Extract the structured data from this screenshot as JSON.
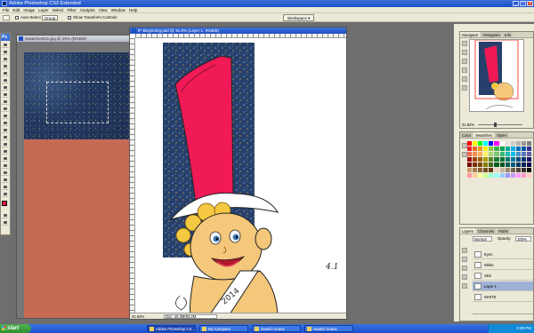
{
  "window": {
    "title": "Adobe Photoshop CS3 Extended",
    "min": "_",
    "max": "□",
    "close": "×"
  },
  "menu": [
    "File",
    "Edit",
    "Image",
    "Layer",
    "Select",
    "Filter",
    "Analysis",
    "View",
    "Window",
    "Help"
  ],
  "options": {
    "auto_select": "Auto-Select",
    "auto_select_value": "Group",
    "show_transform": "Show Transform Controls",
    "workspace": "Workspace ▾"
  },
  "toolbox": {
    "header": "Ps"
  },
  "doc1": {
    "title": "Swatches011.jpg @ 25% (RGB/8)"
  },
  "doc2": {
    "title": "IF-Beginning.psd @ 31.8% (Layer 1, RGB/8)",
    "zoom": "31.82%",
    "doc_size": "Doc: 40.2M/94.2M",
    "signature": "4.1"
  },
  "navigator": {
    "tabs": [
      "Navigator",
      "Histogram",
      "Info"
    ],
    "zoom": "31.82%"
  },
  "swatches": {
    "tabs": [
      "Color",
      "Swatches",
      "Styles"
    ],
    "colors": [
      "#ff0000",
      "#ffff00",
      "#00ff00",
      "#00ffff",
      "#0000ff",
      "#ff00ff",
      "#ffffff",
      "#e6e6e6",
      "#cccccc",
      "#b3b3b3",
      "#999999",
      "#808080",
      "#ed1c24",
      "#f26522",
      "#f7941d",
      "#fff200",
      "#8dc63f",
      "#39b54a",
      "#00a651",
      "#00a99d",
      "#00aeef",
      "#0072bc",
      "#0054a6",
      "#2e3192",
      "#f26c4f",
      "#f68e56",
      "#fbaf5d",
      "#fff568",
      "#acd373",
      "#7cc576",
      "#3cb878",
      "#1cbbb4",
      "#00bff3",
      "#448ccb",
      "#5674b9",
      "#605ca8",
      "#9e0b0f",
      "#a0410d",
      "#a36209",
      "#aba000",
      "#598527",
      "#197b30",
      "#007236",
      "#00746b",
      "#0076a3",
      "#004a80",
      "#003471",
      "#1b1464",
      "#790000",
      "#7b2e00",
      "#7d4900",
      "#827b00",
      "#406618",
      "#005e20",
      "#005826",
      "#005952",
      "#005b7f",
      "#003663",
      "#002157",
      "#0d004c",
      "#c69c6d",
      "#a67c52",
      "#8c6239",
      "#754c24",
      "#603913",
      "#ead6c4",
      "#c7b299",
      "#998675",
      "#736357",
      "#534741",
      "#362f2d",
      "#000000",
      "#ff9999",
      "#ffcc99",
      "#ffff99",
      "#ccff99",
      "#99ffcc",
      "#99ffff",
      "#99ccff",
      "#9999ff",
      "#cc99ff",
      "#ff99ff",
      "#ff99cc",
      "#ffcccc"
    ]
  },
  "layers": {
    "tabs": [
      "Layers",
      "Channels",
      "Paths"
    ],
    "blend_mode": "Normal",
    "opacity_label": "Opacity:",
    "opacity": "100%",
    "items": [
      {
        "name": "Eyes",
        "selected": false
      },
      {
        "name": "White",
        "selected": false
      },
      {
        "name": "Skin",
        "selected": false
      },
      {
        "name": "Layer 1",
        "selected": true
      },
      {
        "name": "WHITE",
        "selected": false
      }
    ]
  },
  "taskbar": {
    "start": "start",
    "tasks": [
      "Adobe Photoshop CS...",
      "My Computer",
      "Swatch Scans",
      "Swatch Scans"
    ],
    "clock": "3:38 PM"
  },
  "colors": {
    "fg": "#e8144c",
    "bg": "#ffffff",
    "accent": "#1d4fc4"
  }
}
